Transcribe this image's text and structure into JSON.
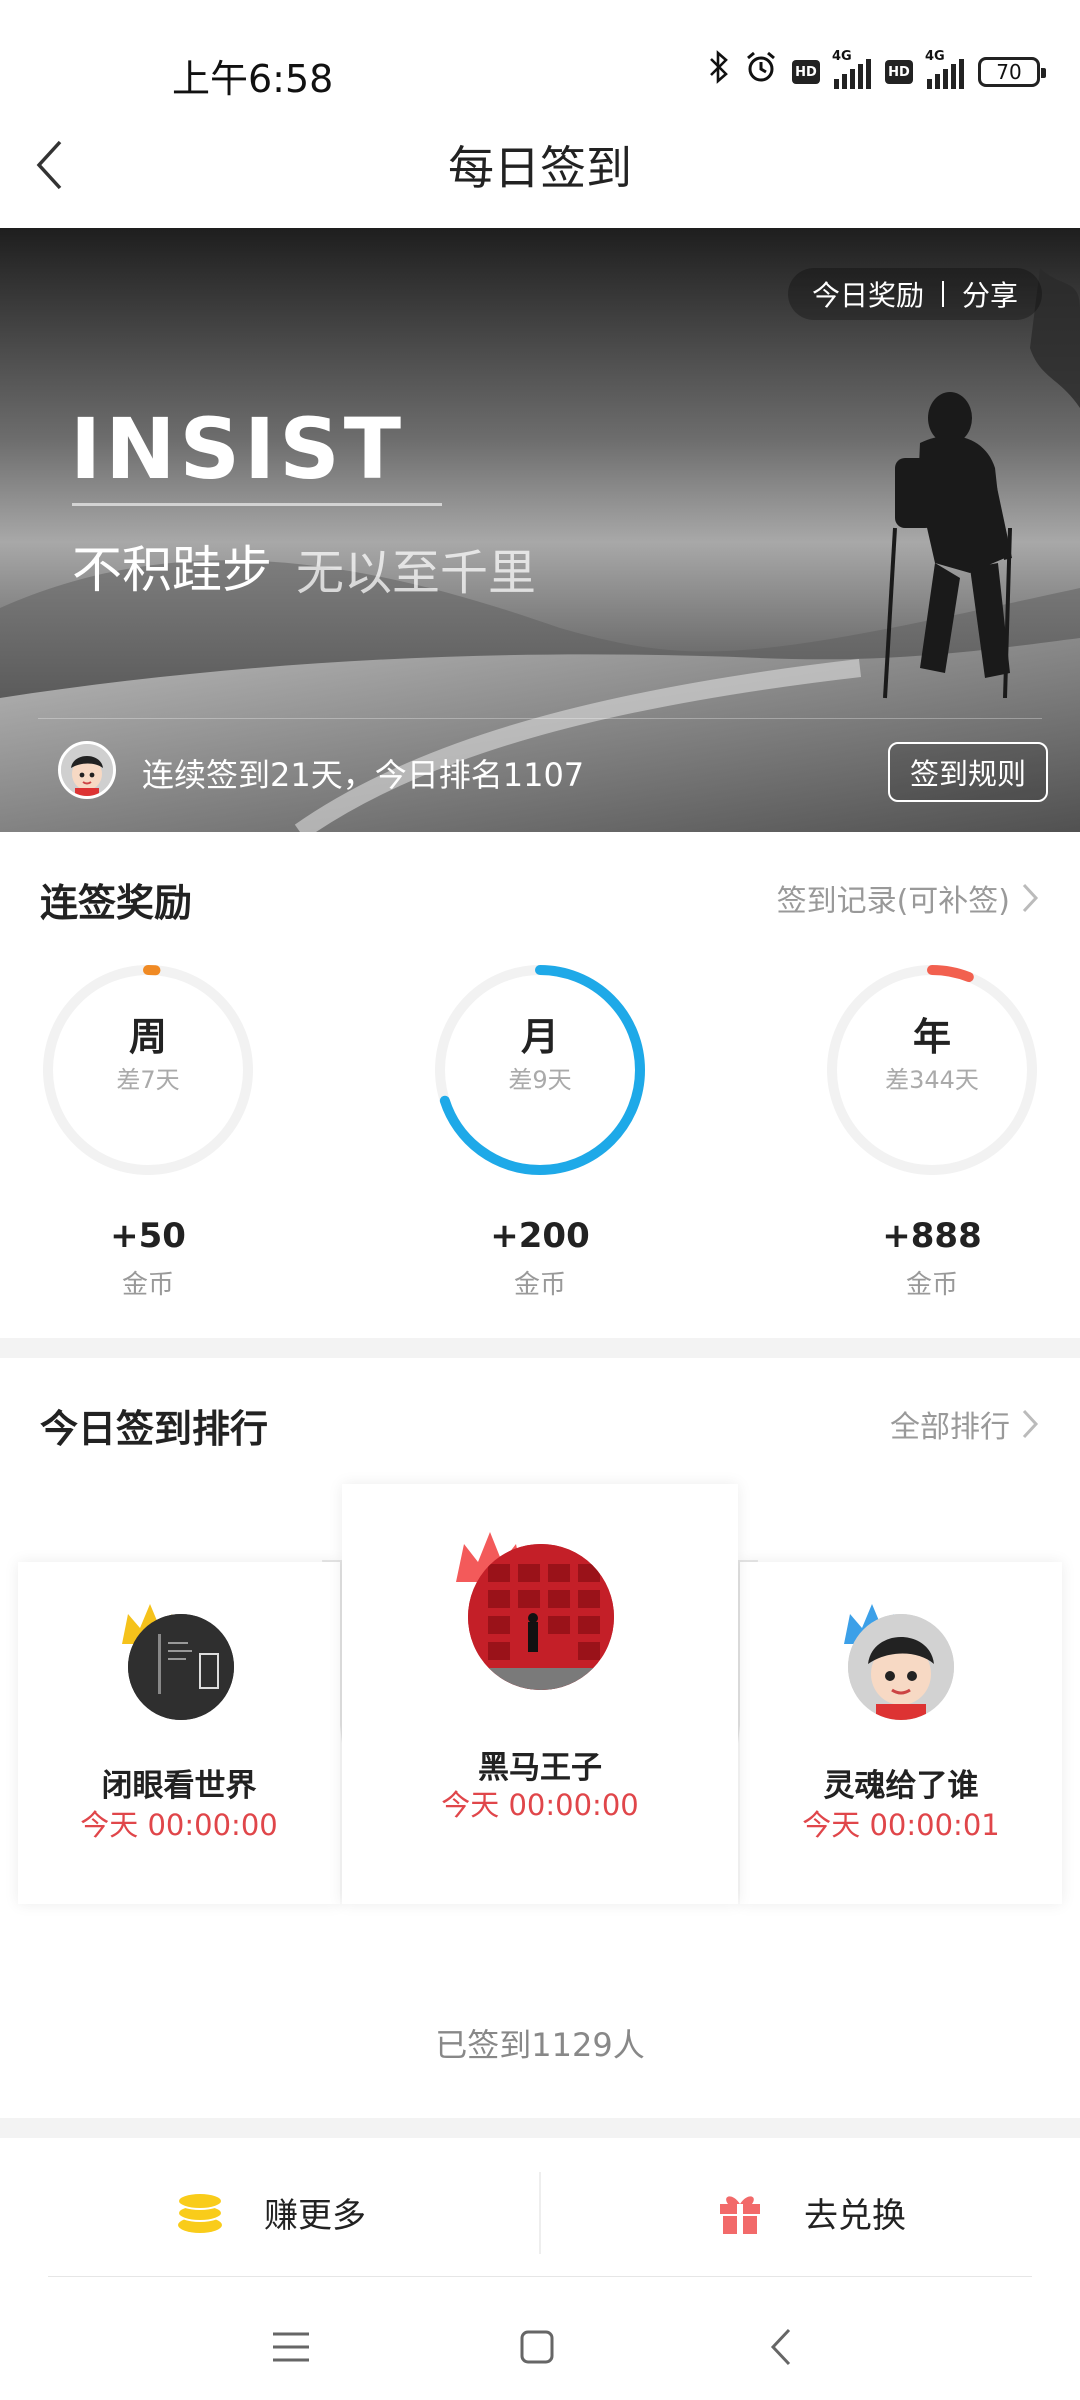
{
  "status_bar": {
    "time": "上午6:58",
    "hd": "HD",
    "network": "4G",
    "battery": "70"
  },
  "nav": {
    "title": "每日签到"
  },
  "hero": {
    "pill_reward": "今日奖励",
    "pill_share": "分享",
    "headline": "INSIST",
    "slogan_1": "不积跬步",
    "slogan_2": "无以至千里",
    "streak_text": "连续签到21天，今日排名1107",
    "rules_button": "签到规则"
  },
  "rewards": {
    "title": "连签奖励",
    "record_link": "签到记录(可补签)",
    "items": [
      {
        "label": "周",
        "remaining": "差7天",
        "amount": "+50",
        "unit": "金币",
        "progress": 0.0,
        "color": "#f08a24"
      },
      {
        "label": "月",
        "remaining": "差9天",
        "amount": "+200",
        "unit": "金币",
        "progress": 0.7,
        "color": "#1ea9e8"
      },
      {
        "label": "年",
        "remaining": "差344天",
        "amount": "+888",
        "unit": "金币",
        "progress": 0.06,
        "color": "#f2604f"
      }
    ]
  },
  "ranking": {
    "title": "今日签到排行",
    "all_link": "全部排行",
    "entries": [
      {
        "rank": 1,
        "name": "黑马王子",
        "time": "今天 00:00:00",
        "crown_color": "#f35a5a"
      },
      {
        "rank": 2,
        "name": "闭眼看世界",
        "time": "今天 00:00:00",
        "crown_color": "#f5c21b"
      },
      {
        "rank": 3,
        "name": "灵魂给了谁",
        "time": "今天 00:00:01",
        "crown_color": "#3ca0e8"
      }
    ],
    "signed_count": "已签到1129人"
  },
  "bottom": {
    "earn_label": "赚更多",
    "redeem_label": "去兑换"
  },
  "colors": {
    "accent_red": "#e0464a",
    "coin_yellow": "#f9cc1a",
    "gift_red": "#f26a6a"
  }
}
